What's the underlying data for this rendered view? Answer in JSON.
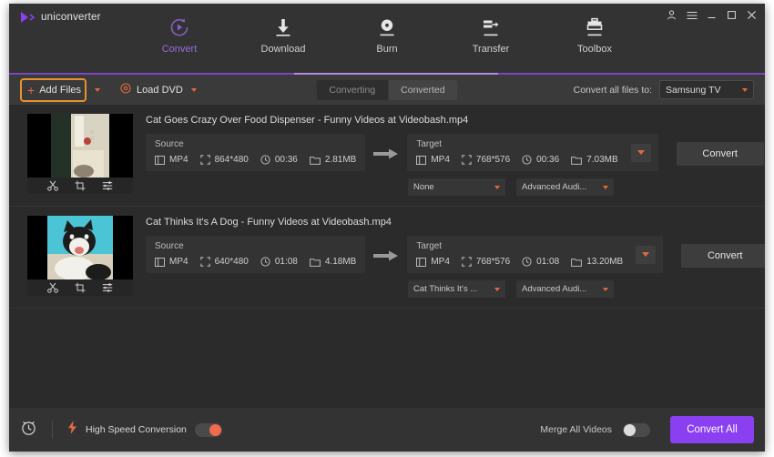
{
  "window": {
    "brand": "uniconverter",
    "controls": [
      {
        "name": "account-icon",
        "glyph": "account"
      },
      {
        "name": "menu-icon",
        "glyph": "hamburger"
      },
      {
        "name": "minimize-button",
        "glyph": "minimize"
      },
      {
        "name": "maximize-button",
        "glyph": "maximize"
      },
      {
        "name": "close-button",
        "glyph": "close"
      }
    ]
  },
  "nav": {
    "active": "Convert",
    "accent": "#9b6ddb",
    "items": [
      {
        "label": "Convert",
        "icon": "convert-play-icon"
      },
      {
        "label": "Download",
        "icon": "download-arrow-icon"
      },
      {
        "label": "Burn",
        "icon": "burn-disc-icon"
      },
      {
        "label": "Transfer",
        "icon": "transfer-icon"
      },
      {
        "label": "Toolbox",
        "icon": "toolbox-icon"
      }
    ]
  },
  "toolbar": {
    "add_files_label": "Add Files",
    "load_dvd_label": "Load DVD",
    "highlight_color": "#e8922d",
    "tabs": [
      {
        "label": "Converting",
        "active": true
      },
      {
        "label": "Converted",
        "active": false
      }
    ],
    "convert_all_to_label": "Convert all files to:",
    "convert_all_to_value": "Samsung TV"
  },
  "files": [
    {
      "title": "Cat Goes Crazy Over Food Dispenser - Funny Videos at Videobash.mp4",
      "thumb_tools": [
        "trim-scissors-icon",
        "crop-icon",
        "effect-sliders-icon"
      ],
      "source": {
        "head": "Source",
        "format": "MP4",
        "resolution": "864*480",
        "duration": "00:36",
        "size": "2.81MB"
      },
      "target": {
        "head": "Target",
        "format": "MP4",
        "resolution": "768*576",
        "duration": "00:36",
        "size": "7.03MB"
      },
      "subtitle_select": "None",
      "audio_select": "Advanced Audi...",
      "convert_label": "Convert"
    },
    {
      "title": "Cat Thinks It's A Dog - Funny Videos at Videobash.mp4",
      "thumb_tools": [
        "trim-scissors-icon",
        "crop-icon",
        "effect-sliders-icon"
      ],
      "source": {
        "head": "Source",
        "format": "MP4",
        "resolution": "640*480",
        "duration": "01:08",
        "size": "4.18MB"
      },
      "target": {
        "head": "Target",
        "format": "MP4",
        "resolution": "768*576",
        "duration": "01:08",
        "size": "13.20MB"
      },
      "subtitle_select": "Cat Thinks It's ...",
      "audio_select": "Advanced Audi...",
      "convert_label": "Convert"
    }
  ],
  "bottom": {
    "high_speed_label": "High Speed Conversion",
    "high_speed_on": true,
    "merge_label": "Merge All Videos",
    "merge_on": false,
    "convert_all_label": "Convert All",
    "convert_all_color": "#8a3ff0"
  }
}
